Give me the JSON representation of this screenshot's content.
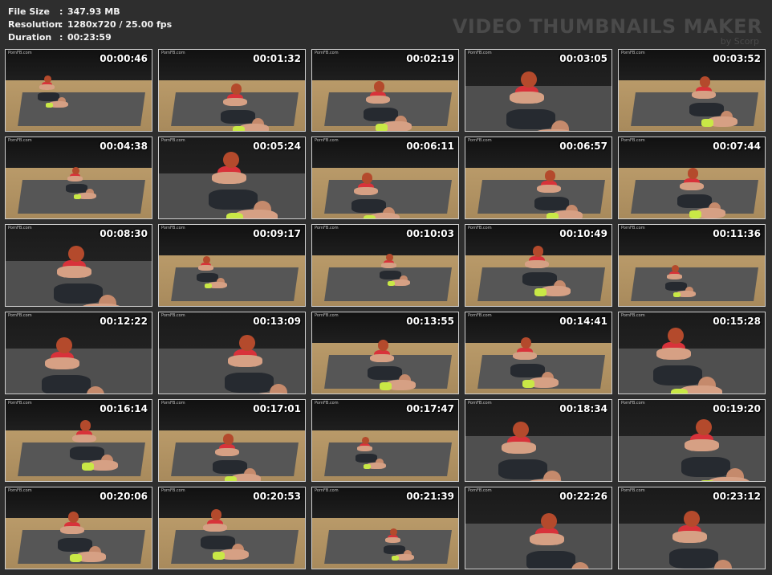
{
  "info": {
    "file_size_label": "File Size",
    "file_size_value": "347.93 MB",
    "resolution_label": "Resolution",
    "resolution_value": "1280x720 / 25.00 fps",
    "duration_label": "Duration",
    "duration_value": "00:23:59",
    "separator": ":"
  },
  "watermark": {
    "title": "VIDEO THUMBNAILS MAKER",
    "subtitle": "by Scorp"
  },
  "thumbnail_logo": "PornFB.com",
  "thumbnails": [
    {
      "time": "00:00:46",
      "shot": "wide"
    },
    {
      "time": "00:01:32",
      "shot": "mid"
    },
    {
      "time": "00:02:19",
      "shot": "mid"
    },
    {
      "time": "00:03:05",
      "shot": "close"
    },
    {
      "time": "00:03:52",
      "shot": "mid"
    },
    {
      "time": "00:04:38",
      "shot": "wide"
    },
    {
      "time": "00:05:24",
      "shot": "close"
    },
    {
      "time": "00:06:11",
      "shot": "mid"
    },
    {
      "time": "00:06:57",
      "shot": "mid"
    },
    {
      "time": "00:07:44",
      "shot": "mid"
    },
    {
      "time": "00:08:30",
      "shot": "close"
    },
    {
      "time": "00:09:17",
      "shot": "wide"
    },
    {
      "time": "00:10:03",
      "shot": "wide"
    },
    {
      "time": "00:10:49",
      "shot": "mid"
    },
    {
      "time": "00:11:36",
      "shot": "wide"
    },
    {
      "time": "00:12:22",
      "shot": "close"
    },
    {
      "time": "00:13:09",
      "shot": "close"
    },
    {
      "time": "00:13:55",
      "shot": "mid"
    },
    {
      "time": "00:14:41",
      "shot": "mid"
    },
    {
      "time": "00:15:28",
      "shot": "close"
    },
    {
      "time": "00:16:14",
      "shot": "mid"
    },
    {
      "time": "00:17:01",
      "shot": "mid"
    },
    {
      "time": "00:17:47",
      "shot": "wide"
    },
    {
      "time": "00:18:34",
      "shot": "close"
    },
    {
      "time": "00:19:20",
      "shot": "close"
    },
    {
      "time": "00:20:06",
      "shot": "mid"
    },
    {
      "time": "00:20:53",
      "shot": "mid"
    },
    {
      "time": "00:21:39",
      "shot": "wide"
    },
    {
      "time": "00:22:26",
      "shot": "close"
    },
    {
      "time": "00:23:12",
      "shot": "close"
    }
  ],
  "colors": {
    "background": "#2e2e2e",
    "text": "#f2f2f2",
    "watermark": "#4a4a4a",
    "thumb_border": "#d0d0d0"
  }
}
